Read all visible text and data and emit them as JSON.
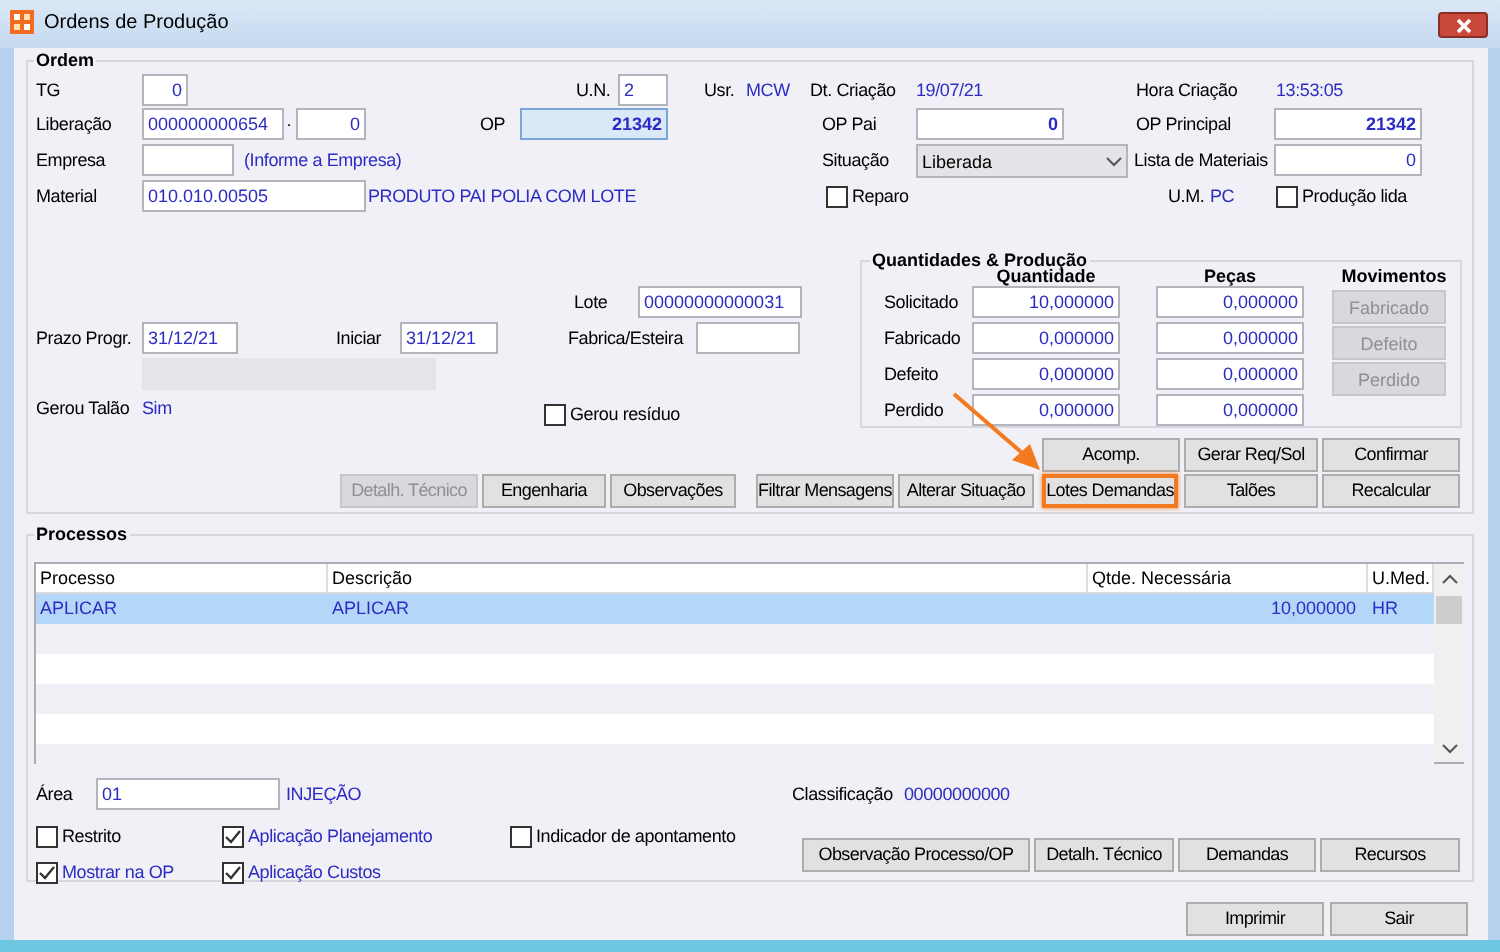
{
  "window": {
    "title": "Ordens de Produção"
  },
  "ordem": {
    "title": "Ordem",
    "items": [
      {
        "kind": "label",
        "text": "TG"
      },
      {
        "kind": "field",
        "value": "0"
      },
      {
        "kind": "label",
        "text": "U.N."
      },
      {
        "kind": "field",
        "value": "2"
      },
      {
        "kind": "label",
        "text": "Usr."
      },
      {
        "kind": "text",
        "text": "MCW"
      },
      {
        "kind": "label",
        "text": "Dt. Criação"
      },
      {
        "kind": "text",
        "text": "19/07/21"
      },
      {
        "kind": "label",
        "text": "Hora Criação"
      },
      {
        "kind": "text",
        "text": "13:53:05"
      },
      {
        "kind": "label",
        "text": "Liberação"
      },
      {
        "kind": "field",
        "value": "000000000654"
      },
      {
        "kind": "label",
        "text": "·"
      },
      {
        "kind": "field",
        "value": "0"
      },
      {
        "kind": "label",
        "text": "OP"
      },
      {
        "kind": "field",
        "value": "21342"
      },
      {
        "kind": "label",
        "text": "OP Pai"
      },
      {
        "kind": "field",
        "value": "0"
      },
      {
        "kind": "label",
        "text": "OP Principal"
      },
      {
        "kind": "field",
        "value": "21342"
      },
      {
        "kind": "label",
        "text": "Empresa"
      },
      {
        "kind": "field"
      },
      {
        "kind": "text",
        "text": "(Informe a Empresa)"
      },
      {
        "kind": "label",
        "text": "Situação"
      },
      {
        "kind": "combo",
        "value": "Liberada"
      },
      {
        "kind": "label",
        "text": "Lista de Materiais"
      },
      {
        "kind": "field",
        "value": "0"
      },
      {
        "kind": "label",
        "text": "Material"
      },
      {
        "kind": "field",
        "value": "010.010.00505"
      },
      {
        "kind": "text",
        "text": "PRODUTO PAI POLIA COM LOTE"
      },
      {
        "kind": "checkbox",
        "label": "Reparo",
        "checked": false
      },
      {
        "kind": "label",
        "text": "U.M."
      },
      {
        "kind": "text",
        "text": "PC"
      },
      {
        "kind": "checkbox",
        "label": "Produção lida",
        "checked": false
      },
      {
        "kind": "label",
        "text": "Lote"
      },
      {
        "kind": "field",
        "value": "00000000000031"
      },
      {
        "kind": "label",
        "text": "Prazo Progr."
      },
      {
        "kind": "field",
        "value": "31/12/21"
      },
      {
        "kind": "label",
        "text": "Iniciar"
      },
      {
        "kind": "field",
        "value": "31/12/21"
      },
      {
        "kind": "label",
        "text": "Fabrica/Esteira"
      },
      {
        "kind": "field"
      },
      {
        "kind": "label",
        "text": "Gerou Talão"
      },
      {
        "kind": "text",
        "text": "Sim"
      },
      {
        "kind": "checkbox",
        "label": "Gerou resíduo",
        "checked": false
      }
    ],
    "quantities": {
      "title": "Quantidades & Produção",
      "columns": [
        "Quantidade",
        "Peças",
        "Movimentos"
      ],
      "rows": [
        {
          "label": "Solicitado",
          "quantidade": "10,000000",
          "pecas": "0,000000",
          "movement_button": {
            "label": "Fabricado",
            "disabled": true
          }
        },
        {
          "label": "Fabricado",
          "quantidade": "0,000000",
          "pecas": "0,000000",
          "movement_button": {
            "label": "Defeito",
            "disabled": true
          }
        },
        {
          "label": "Defeito",
          "quantidade": "0,000000",
          "pecas": "0,000000",
          "movement_button": {
            "label": "Perdido",
            "disabled": true
          }
        },
        {
          "label": "Perdido",
          "quantidade": "0,000000",
          "pecas": "0,000000"
        }
      ]
    },
    "buttons": [
      {
        "label": "Acomp.",
        "disabled": false,
        "highlighted": false
      },
      {
        "label": "Gerar Req/Sol",
        "disabled": false,
        "highlighted": false
      },
      {
        "label": "Confirmar",
        "disabled": false,
        "highlighted": false
      },
      {
        "label": "Detalh. Técnico",
        "disabled": true,
        "highlighted": false
      },
      {
        "label": "Engenharia",
        "disabled": false,
        "highlighted": false
      },
      {
        "label": "Observações",
        "disabled": false,
        "highlighted": false
      },
      {
        "label": "Filtrar Mensagens",
        "disabled": false,
        "highlighted": false
      },
      {
        "label": "Alterar Situação",
        "disabled": false,
        "highlighted": false
      },
      {
        "label": "Lotes Demandas",
        "disabled": false,
        "highlighted": true
      },
      {
        "label": "Talões",
        "disabled": false,
        "highlighted": false
      },
      {
        "label": "Recalcular",
        "disabled": false,
        "highlighted": false
      }
    ]
  },
  "processos": {
    "title": "Processos",
    "table": {
      "columns": [
        "Processo",
        "Descrição",
        "Qtde. Necessária",
        "U.Med."
      ],
      "rows": [
        {
          "cells": [
            "APLICAR",
            "APLICAR",
            "10,000000",
            "HR"
          ],
          "selected": true
        }
      ]
    },
    "items": [
      {
        "kind": "label",
        "text": "Área"
      },
      {
        "kind": "field",
        "value": "01"
      },
      {
        "kind": "text",
        "text": "INJEÇÃO"
      },
      {
        "kind": "label",
        "text": "Classificação"
      },
      {
        "kind": "text",
        "text": "00000000000"
      },
      {
        "kind": "checkbox",
        "label": "Restrito",
        "checked": false
      },
      {
        "kind": "checkbox",
        "label": "Aplicação Planejamento",
        "checked": true
      },
      {
        "kind": "checkbox",
        "label": "Indicador de apontamento",
        "checked": false
      },
      {
        "kind": "checkbox",
        "label": "Mostrar na OP",
        "checked": true
      },
      {
        "kind": "checkbox",
        "label": "Aplicação Custos",
        "checked": true
      }
    ],
    "buttons": [
      "Observação Processo/OP",
      "Detalh. Técnico",
      "Demandas",
      "Recursos"
    ]
  },
  "footer_buttons": [
    "Imprimir",
    "Sair"
  ]
}
